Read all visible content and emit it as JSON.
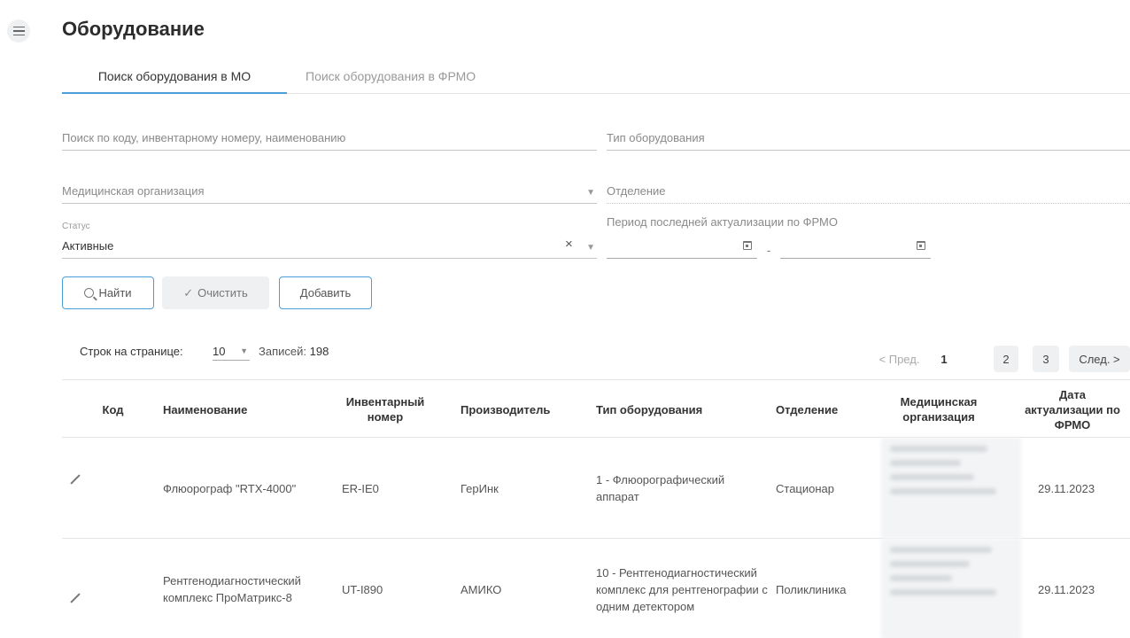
{
  "header": {
    "title": "Оборудование"
  },
  "tabs": [
    {
      "label": "Поиск оборудования в МО",
      "active": true
    },
    {
      "label": "Поиск оборудования в ФРМО",
      "active": false
    }
  ],
  "filters": {
    "search_placeholder": "Поиск по коду, инвентарному номеру, наименованию",
    "equipment_type_placeholder": "Тип оборудования",
    "organization_placeholder": "Медицинская организация",
    "department_placeholder": "Отделение",
    "status_label": "Статус",
    "status_value": "Активные",
    "period_label": "Период последней актуализации по ФРМО",
    "date_separator": "-"
  },
  "buttons": {
    "find": "Найти",
    "clear": "Очистить",
    "add": "Добавить"
  },
  "pagination": {
    "rows_per_page_label": "Строк на странице:",
    "rows_per_page_value": "10",
    "records_label": "Записей:",
    "records_count": "198",
    "prev": "< Пред.",
    "pages": [
      "1",
      "2",
      "3"
    ],
    "current_page": "1",
    "next": "След. >"
  },
  "table": {
    "headers": {
      "code": "Код",
      "name": "Наименование",
      "inventory": "Инвентарный номер",
      "manufacturer": "Производитель",
      "type": "Тип оборудования",
      "department": "Отделение",
      "organization": "Медицинская организация",
      "date": "Дата актуализации по ФРМО"
    },
    "rows": [
      {
        "name": "Флюорограф \"RTX-4000\"",
        "inventory": "ER-IE0",
        "manufacturer": "ГерИнк",
        "type": "1 - Флюорографический аппарат",
        "department": "Стационар",
        "date": "29.11.2023"
      },
      {
        "name": "Рентгенодиагностический комплекс ПроМатрикс-8",
        "inventory": "UT-I890",
        "manufacturer": "АМИКО",
        "type": "10 - Рентгенодиагностический комплекс для рентгенографии с одним детектором",
        "department": "Поликлиника",
        "date": "29.11.2023"
      }
    ]
  },
  "colors": {
    "accent": "#4a9fd8",
    "muted_bg": "#eef0f2",
    "border": "#e4e4e4"
  }
}
